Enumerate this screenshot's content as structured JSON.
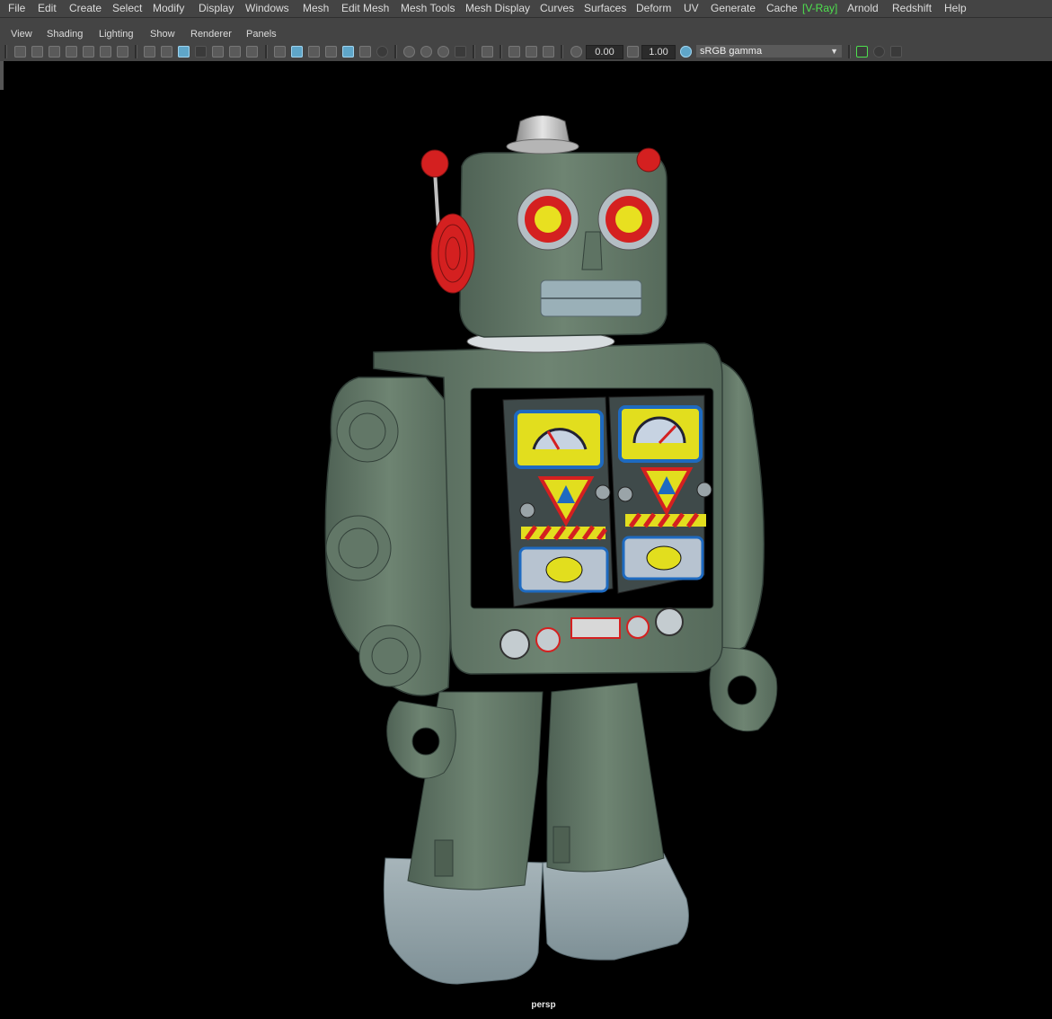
{
  "menubar": {
    "items": [
      "File",
      "Edit",
      "Create",
      "Select",
      "Modify",
      "Display",
      "Windows",
      "Mesh",
      "Edit Mesh",
      "Mesh Tools",
      "Mesh Display",
      "Curves",
      "Surfaces",
      "Deform",
      "UV",
      "Generate",
      "Cache",
      "V-Ray",
      "Arnold",
      "Redshift",
      "Help"
    ]
  },
  "panel_menu": {
    "items": [
      "View",
      "Shading",
      "Lighting",
      "Show",
      "Renderer",
      "Panels"
    ]
  },
  "toolbar": {
    "exposure_value": "0.00",
    "gamma_value": "1.00",
    "color_space": "sRGB gamma"
  },
  "viewport": {
    "camera_label": "persp",
    "background_color": "#000000"
  },
  "colors": {
    "menu_bg": "#444444",
    "vray_label": "#4ee04e",
    "active_icon": "#5fa6c9",
    "robot_body": "#6b8070",
    "robot_feet": "#8ea0a6",
    "robot_accent_red": "#d42020",
    "robot_accent_yellow": "#e8e020"
  }
}
